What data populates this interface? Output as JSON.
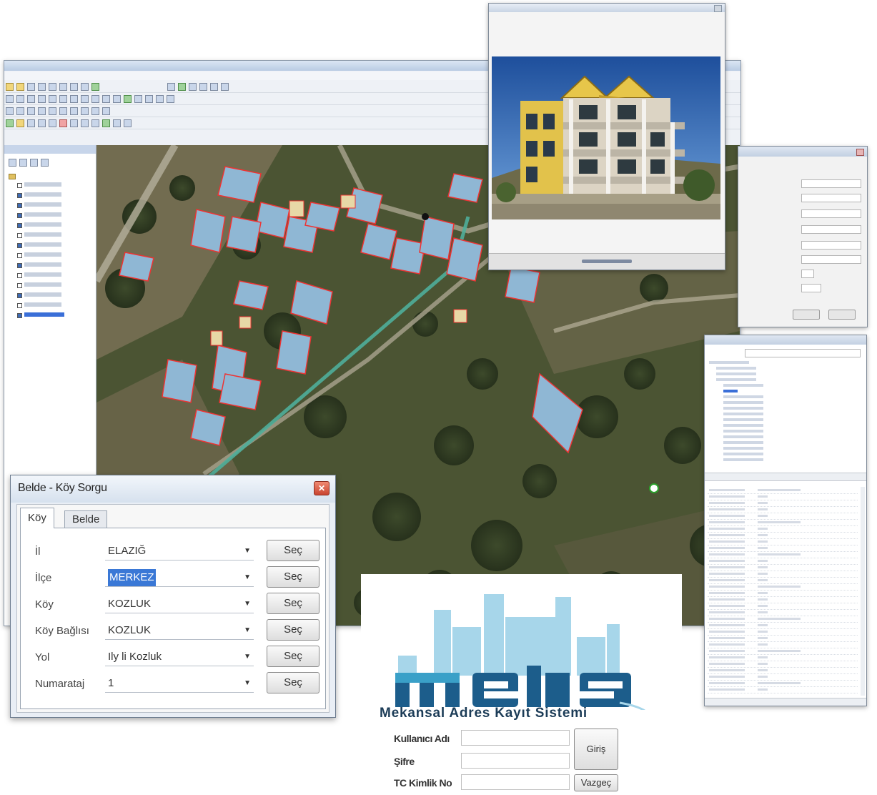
{
  "gis": {
    "toc_items": [
      {
        "label": "",
        "checked": false
      },
      {
        "label": "",
        "checked": true
      },
      {
        "label": "",
        "checked": true
      },
      {
        "label": "",
        "checked": true
      },
      {
        "label": "",
        "checked": true
      },
      {
        "label": "",
        "checked": false
      },
      {
        "label": "",
        "checked": true
      },
      {
        "label": "",
        "checked": false
      },
      {
        "label": "",
        "checked": true
      },
      {
        "label": "",
        "checked": false
      },
      {
        "label": "",
        "checked": false
      },
      {
        "label": "",
        "checked": true
      },
      {
        "label": "",
        "checked": false
      },
      {
        "label": "",
        "checked": true,
        "selected": true
      }
    ]
  },
  "belde_dialog": {
    "title": "Belde - Köy Sorgu",
    "tabs": [
      "Köy",
      "Belde"
    ],
    "fields": [
      {
        "label": "İl",
        "value": "ELAZIĞ",
        "highlighted": false
      },
      {
        "label": "İlçe",
        "value": "MERKEZ",
        "highlighted": true
      },
      {
        "label": "Köy",
        "value": "KOZLUK",
        "highlighted": false
      },
      {
        "label": "Köy Bağlısı",
        "value": "KOZLUK",
        "highlighted": false
      },
      {
        "label": "Yol",
        "value": "Ily  li  Kozluk",
        "highlighted": false
      },
      {
        "label": "Numarataj",
        "value": "1",
        "highlighted": false
      }
    ],
    "select_button_label": "Seç",
    "close_glyph": "✕"
  },
  "login": {
    "logo_text": "maks",
    "subtitle": "Mekansal Adres Kayıt Sistemi",
    "labels": {
      "username": "Kullanıcı Adı",
      "password": "Şifre",
      "tc_no": "TC Kimlik No"
    },
    "login_button": "Giriş",
    "cancel_button": "Vazgeç"
  },
  "colors": {
    "logo_blue": "#1c5d8b",
    "logo_cyan": "#3aa0c8",
    "logo_light": "#a7d6ea",
    "highlight": "#3a78d6"
  }
}
